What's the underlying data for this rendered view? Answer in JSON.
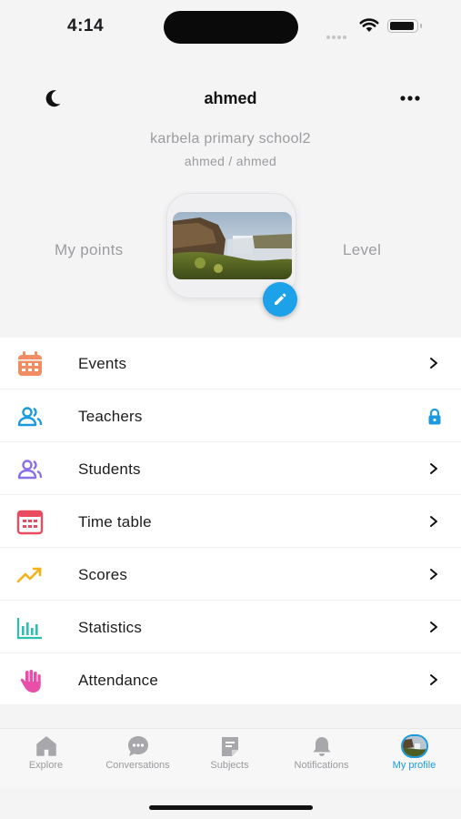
{
  "status_bar": {
    "time": "4:14"
  },
  "header": {
    "username": "ahmed",
    "moon_icon": "moon-icon",
    "more_icon": "more-icon",
    "school": "karbela primary school2",
    "user_path": "ahmed / ahmed"
  },
  "profile": {
    "points_label": "My points",
    "level_label": "Level",
    "edit_icon": "pencil-icon"
  },
  "menu": {
    "items": [
      {
        "label": "Events",
        "icon": "calendar-icon",
        "color": "#f28c63",
        "trailing": "chevron"
      },
      {
        "label": "Teachers",
        "icon": "teachers-icon",
        "color": "#1b9ae0",
        "trailing": "lock"
      },
      {
        "label": "Students",
        "icon": "students-icon",
        "color": "#8b6fe8",
        "trailing": "chevron"
      },
      {
        "label": "Time table",
        "icon": "timetable-icon",
        "color": "#ea4b5e",
        "trailing": "chevron"
      },
      {
        "label": "Scores",
        "icon": "trending-icon",
        "color": "#f2b319",
        "trailing": "chevron"
      },
      {
        "label": "Statistics",
        "icon": "bar-chart-icon",
        "color": "#2bbfae",
        "trailing": "chevron"
      },
      {
        "label": "Attendance",
        "icon": "hand-icon",
        "color": "#e84fa8",
        "trailing": "chevron"
      }
    ]
  },
  "tabbar": {
    "tabs": [
      {
        "label": "Explore",
        "icon": "home-icon",
        "active": false
      },
      {
        "label": "Conversations",
        "icon": "chat-icon",
        "active": false
      },
      {
        "label": "Subjects",
        "icon": "note-icon",
        "active": false
      },
      {
        "label": "Notifications",
        "icon": "bell-icon",
        "active": false
      },
      {
        "label": "My profile",
        "icon": "profile-avatar",
        "active": true
      }
    ],
    "active_color": "#1b9ae0"
  }
}
